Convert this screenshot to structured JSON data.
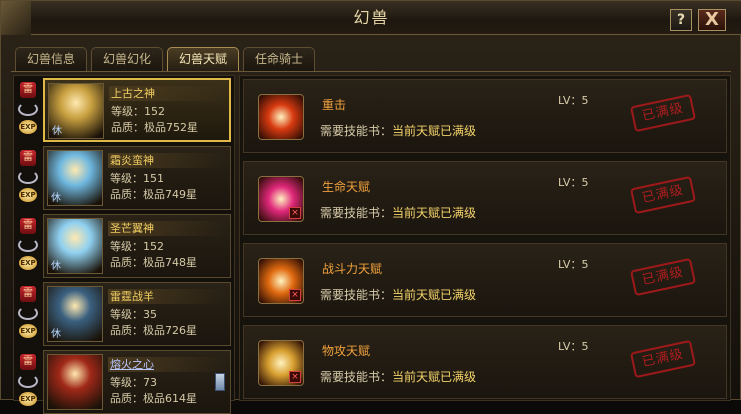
{
  "window": {
    "title": "幻兽",
    "help_label": "?",
    "close_label": "X"
  },
  "tabs": [
    {
      "label": "幻兽信息",
      "active": false
    },
    {
      "label": "幻兽幻化",
      "active": false
    },
    {
      "label": "幻兽天赋",
      "active": true
    },
    {
      "label": "任命骑士",
      "active": false
    }
  ],
  "beasts": [
    {
      "name": "上古之神",
      "level_label": "等级：",
      "level": "152",
      "quality_label": "品质：",
      "quality": "极品752星",
      "lock": "雷",
      "status": "休",
      "exp": "EXP",
      "selected": false,
      "active": true,
      "color": "#c8a040"
    },
    {
      "name": "霜炎蛮神",
      "level_label": "等级：",
      "level": "151",
      "quality_label": "品质：",
      "quality": "极品749星",
      "lock": "雷",
      "status": "休",
      "exp": "EXP",
      "selected": false,
      "active": false,
      "color": "#6fb8e0"
    },
    {
      "name": "圣芒翼神",
      "level_label": "等级：",
      "level": "152",
      "quality_label": "品质：",
      "quality": "极品748星",
      "lock": "雷",
      "status": "休",
      "exp": "EXP",
      "selected": false,
      "active": false,
      "color": "#8fd0f0"
    },
    {
      "name": "雷霆战羊",
      "level_label": "等级：",
      "level": "35",
      "quality_label": "品质：",
      "quality": "极品726星",
      "lock": "雷",
      "status": "休",
      "exp": "EXP",
      "selected": false,
      "active": false,
      "color": "#3a6080"
    },
    {
      "name": "熔火之心",
      "level_label": "等级：",
      "level": "73",
      "quality_label": "品质：",
      "quality": "极品614星",
      "lock": "雷",
      "status": "",
      "exp": "EXP",
      "selected": true,
      "active": false,
      "color": "#a02818"
    }
  ],
  "talents": [
    {
      "name": "重击",
      "req_label": "需要技能书：",
      "req_value": "当前天赋已满级",
      "lv_label": "LV：",
      "lv": "5",
      "stamp": "已满级",
      "icon": "fist-icon",
      "color": "#d83a10",
      "locked": false
    },
    {
      "name": "生命天赋",
      "req_label": "需要技能书：",
      "req_value": "当前天赋已满级",
      "lv_label": "LV：",
      "lv": "5",
      "stamp": "已满级",
      "icon": "heart-icon",
      "color": "#e0287a",
      "locked": true
    },
    {
      "name": "战斗力天赋",
      "req_label": "需要技能书：",
      "req_value": "当前天赋已满级",
      "lv_label": "LV：",
      "lv": "5",
      "stamp": "已满级",
      "icon": "flame-ring-icon",
      "color": "#e06a10",
      "locked": true
    },
    {
      "name": "物攻天赋",
      "req_label": "需要技能书：",
      "req_value": "当前天赋已满级",
      "lv_label": "LV：",
      "lv": "5",
      "stamp": "已满级",
      "icon": "sword-shield-icon",
      "color": "#d8a030",
      "locked": true
    }
  ]
}
